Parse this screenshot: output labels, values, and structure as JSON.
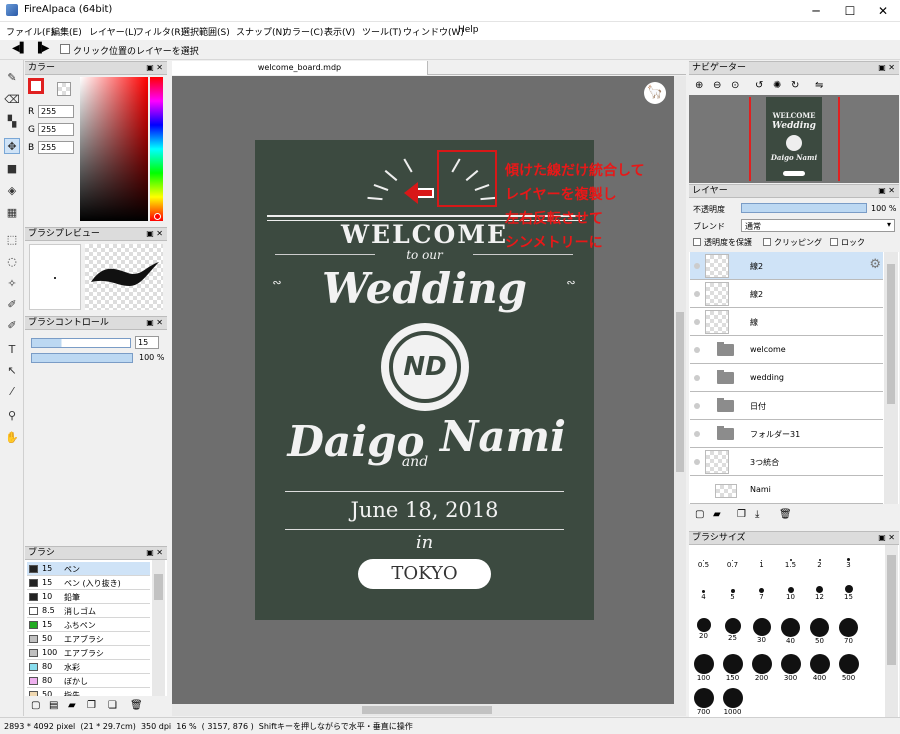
{
  "window": {
    "title": "FireAlpaca (64bit)",
    "min": "─",
    "max": "☐",
    "close": "✕"
  },
  "menu": [
    "ファイル(F)",
    "編集(E)",
    "レイヤー(L)",
    "フィルタ(R)",
    "選択範囲(S)",
    "スナップ(N)",
    "カラー(C)",
    "表示(V)",
    "ツール(T)",
    "ウィンドウ(W)",
    "Help"
  ],
  "toolbar": {
    "checkbox_label": "クリック位置のレイヤーを選択"
  },
  "color_panel": {
    "title": "カラー",
    "r_label": "R",
    "g_label": "G",
    "b_label": "B",
    "r": "255",
    "g": "255",
    "b": "255"
  },
  "brush_preview": {
    "title": "ブラシプレビュー"
  },
  "brush_control": {
    "title": "ブラシコントロール",
    "size": "15",
    "opacity": "100 %"
  },
  "brush_panel": {
    "title": "ブラシ",
    "items": [
      {
        "size": "15",
        "name": "ペン",
        "color": "#222222",
        "selected": true
      },
      {
        "size": "15",
        "name": "ペン (入り抜き)",
        "color": "#222222"
      },
      {
        "size": "10",
        "name": "鉛筆",
        "color": "#222222"
      },
      {
        "size": "8.5",
        "name": "消しゴム",
        "color": "#ffffff"
      },
      {
        "size": "15",
        "name": "ふちペン",
        "color": "#22aa22"
      },
      {
        "size": "50",
        "name": "エアブラシ",
        "color": "#c0c0c0"
      },
      {
        "size": "100",
        "name": "エアブラシ",
        "color": "#c0c0c0"
      },
      {
        "size": "80",
        "name": "水彩",
        "color": "#88ddee"
      },
      {
        "size": "80",
        "name": "ぼかし",
        "color": "#eeb0ee"
      },
      {
        "size": "50",
        "name": "指先",
        "color": "#f0d8b0"
      }
    ]
  },
  "document": {
    "tab": "welcome_board.mdp"
  },
  "board": {
    "welcome": "WELCOME",
    "to_our": "to our",
    "wedding": "Wedding",
    "monogram": "ND",
    "daigo": "Daigo",
    "and": "and",
    "nami": "Nami",
    "date": "June 18, 2018",
    "in": "in",
    "place": "TOKYO"
  },
  "annotation": [
    "傾けた線だけ統合して",
    "レイヤーを複製し",
    "左右反転させて",
    "シンメトリーに"
  ],
  "navigator": {
    "title": "ナビゲーター",
    "mini_welcome": "WELCOME",
    "mini_wedding": "Wedding",
    "mini_names": "Daigo Nami"
  },
  "layer_panel": {
    "title": "レイヤー",
    "opacity_label": "不透明度",
    "opacity": "100 %",
    "blend_label": "ブレンド",
    "blend": "通常",
    "protect": "透明度を保護",
    "clipping": "クリッピング",
    "lock": "ロック",
    "layers": [
      {
        "name": "線2",
        "type": "layer",
        "selected": true
      },
      {
        "name": "線2",
        "type": "layer"
      },
      {
        "name": "線",
        "type": "layer"
      },
      {
        "name": "welcome",
        "type": "folder"
      },
      {
        "name": "wedding",
        "type": "folder"
      },
      {
        "name": "日付",
        "type": "folder"
      },
      {
        "name": "フォルダー31",
        "type": "folder"
      },
      {
        "name": "3つ統合",
        "type": "layer"
      },
      {
        "name": "Nami",
        "type": "layer"
      }
    ]
  },
  "brush_size": {
    "title": "ブラシサイズ",
    "sizes": [
      "0.5",
      "0.7",
      "1",
      "1.5",
      "2",
      "3",
      "4",
      "5",
      "7",
      "10",
      "12",
      "15",
      "20",
      "25",
      "30",
      "40",
      "50",
      "70",
      "100",
      "150",
      "200",
      "300",
      "400",
      "500",
      "700",
      "1000"
    ]
  },
  "statusbar": {
    "text": "2893 * 4092 pixel  (21 * 29.7cm)  350 dpi  16 %  ( 3157, 876 )  Shiftキーを押しながらで水平・垂直に操作"
  }
}
